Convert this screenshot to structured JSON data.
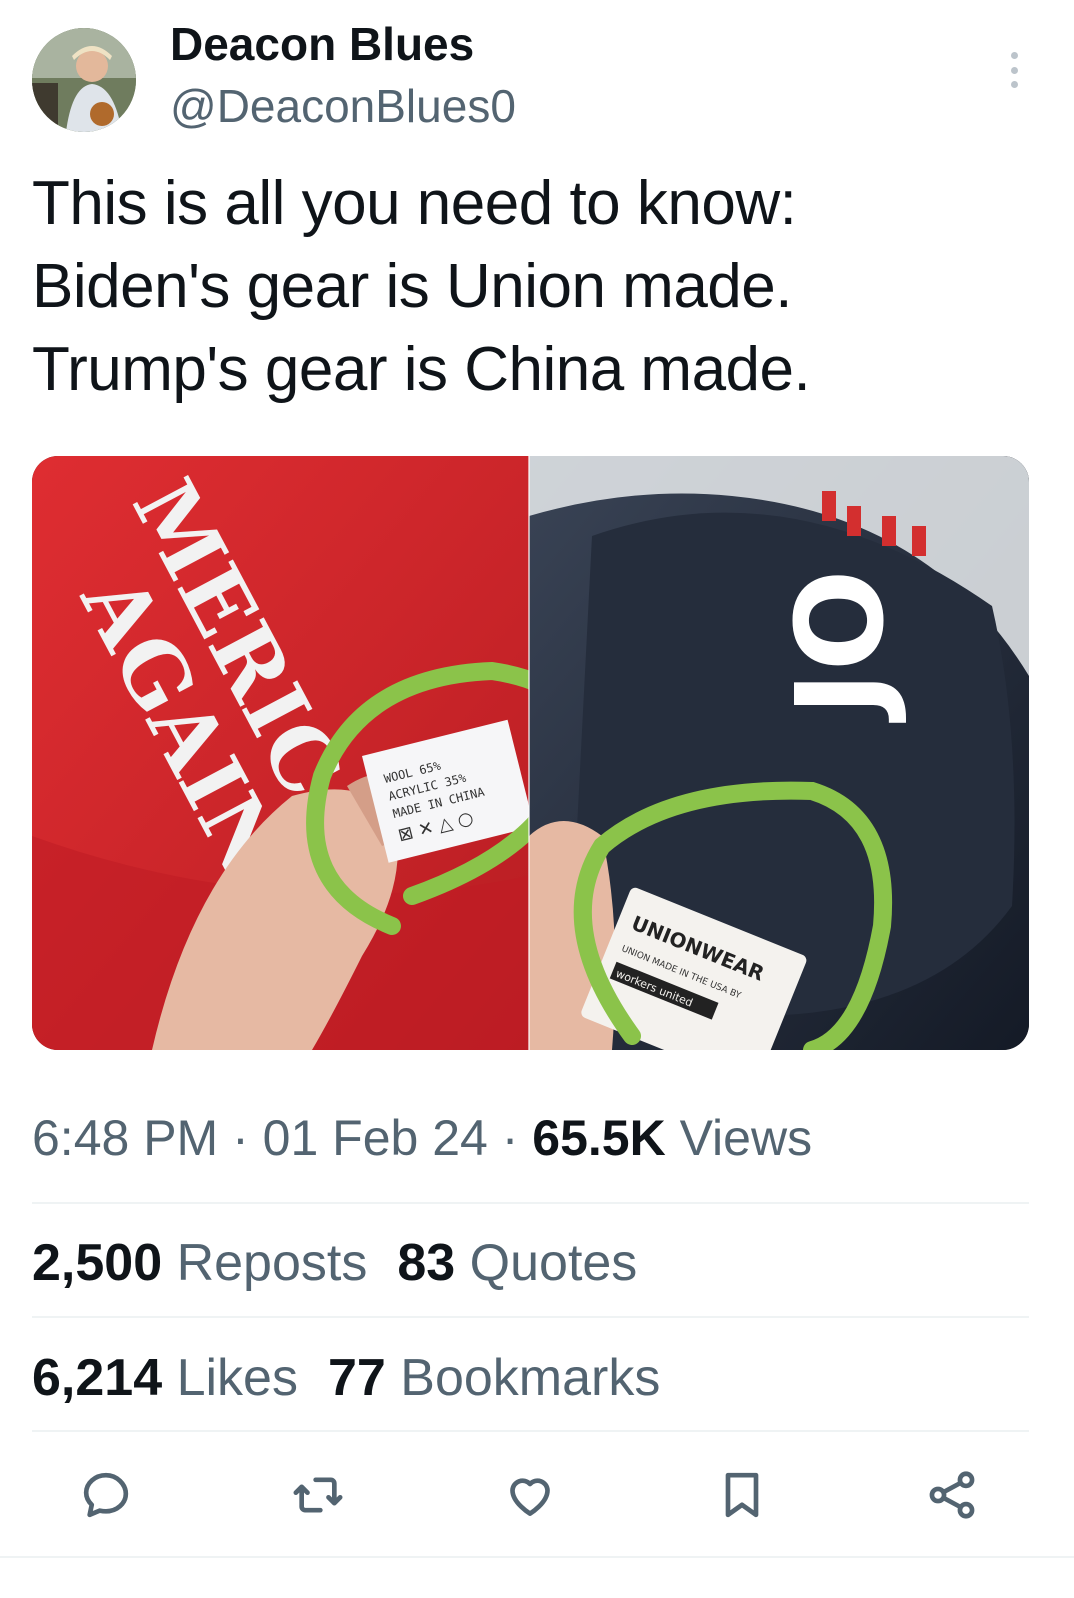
{
  "author": {
    "display_name": "Deacon Blues",
    "handle": "@DeaconBlues0"
  },
  "tweet": {
    "text": "This is all you need to know:\nBiden's gear is Union made.\nTrump's gear is China made."
  },
  "media": {
    "left_label_text": [
      "MERICA",
      "AGAIN"
    ],
    "left_tag_text": [
      "WOOL 65%",
      "ACRYLIC 35%",
      "MADE IN CHINA"
    ],
    "right_cap_text": "JO",
    "right_tag_text": [
      "UNIONWEAR",
      "UNION MADE IN THE USA BY",
      "workers united"
    ],
    "accent_circle_color": "#8bc34a"
  },
  "meta": {
    "time": "6:48 PM",
    "sep1": " · ",
    "date": "01 Feb 24",
    "sep2": " · ",
    "views_count": "65.5K",
    "views_label": " Views"
  },
  "stats": {
    "reposts_count": "2,500",
    "reposts_label": " Reposts",
    "quotes_count": "83",
    "quotes_label": " Quotes",
    "likes_count": "6,214",
    "likes_label": " Likes",
    "bookmarks_count": "77",
    "bookmarks_label": " Bookmarks"
  },
  "actions": {
    "icons": [
      "reply-icon",
      "repost-icon",
      "like-icon",
      "bookmark-icon",
      "share-icon"
    ],
    "icon_color": "#536471"
  }
}
